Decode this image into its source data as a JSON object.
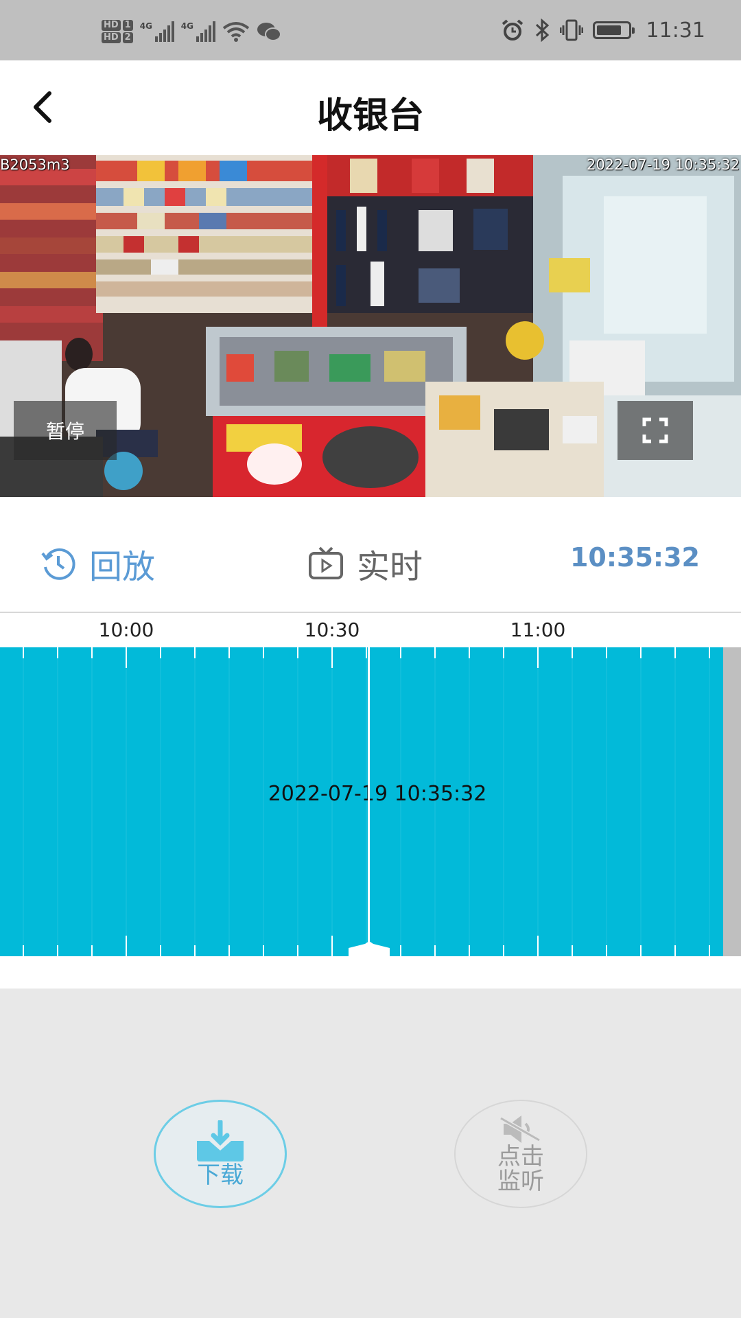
{
  "status_bar": {
    "sim1_label": "HD",
    "sim1_num": "1",
    "sim2_label": "HD",
    "sim2_num": "2",
    "net1": "4G",
    "net2": "4G",
    "time": "11:31",
    "battery_level": 0.8
  },
  "header": {
    "title": "收银台",
    "back_icon": "chevron-left-icon"
  },
  "video": {
    "camera_id": "B2053m3",
    "timestamp": "2022-07-19 10:35:32",
    "pause_label": "暂停",
    "fullscreen_icon": "fullscreen-icon"
  },
  "mode_bar": {
    "playback_label": "回放",
    "live_label": "实时",
    "current_time": "10:35:32",
    "accent_color": "#5b9bd5"
  },
  "timeline": {
    "ticks": [
      "10:00",
      "10:30",
      "11:00"
    ],
    "cursor_datetime": "2022-07-19 10:35:32",
    "track_color": "#02bad9"
  },
  "actions": {
    "download_label": "下载",
    "listen_label_line1": "点击",
    "listen_label_line2": "监听"
  }
}
